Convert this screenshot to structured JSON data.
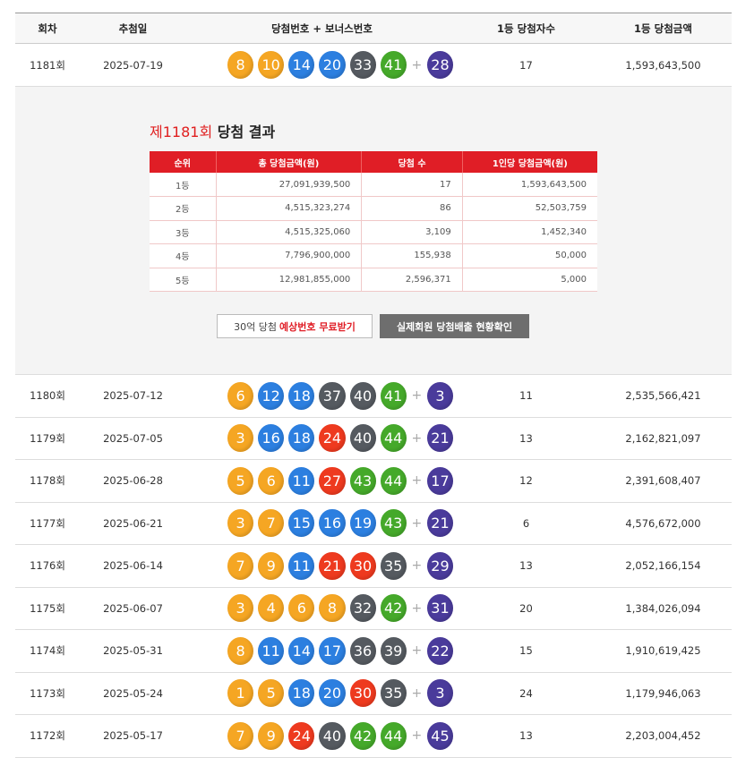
{
  "headers": {
    "round": "회차",
    "date": "추첨일",
    "numbers": "당첨번호 + 보너스번호",
    "winners": "1등 당첨자수",
    "prize": "1등 당첨금액"
  },
  "colors": {
    "yellow": "#f5a623",
    "blue": "#2c7fe0",
    "red": "#ee3a1f",
    "gray": "#555a60",
    "green": "#45a92a",
    "purple": "#4a3b9b",
    "accent_red": "#e01e26"
  },
  "draws": [
    {
      "round": "1181회",
      "date": "2025-07-19",
      "numbers": [
        8,
        10,
        14,
        20,
        33,
        41
      ],
      "bonus": 28,
      "winners": "17",
      "prize": "1,593,643,500"
    },
    {
      "round": "1180회",
      "date": "2025-07-12",
      "numbers": [
        6,
        12,
        18,
        37,
        40,
        41
      ],
      "bonus": 3,
      "winners": "11",
      "prize": "2,535,566,421"
    },
    {
      "round": "1179회",
      "date": "2025-07-05",
      "numbers": [
        3,
        16,
        18,
        24,
        40,
        44
      ],
      "bonus": 21,
      "winners": "13",
      "prize": "2,162,821,097"
    },
    {
      "round": "1178회",
      "date": "2025-06-28",
      "numbers": [
        5,
        6,
        11,
        27,
        43,
        44
      ],
      "bonus": 17,
      "winners": "12",
      "prize": "2,391,608,407"
    },
    {
      "round": "1177회",
      "date": "2025-06-21",
      "numbers": [
        3,
        7,
        15,
        16,
        19,
        43
      ],
      "bonus": 21,
      "winners": "6",
      "prize": "4,576,672,000"
    },
    {
      "round": "1176회",
      "date": "2025-06-14",
      "numbers": [
        7,
        9,
        11,
        21,
        30,
        35
      ],
      "bonus": 29,
      "winners": "13",
      "prize": "2,052,166,154"
    },
    {
      "round": "1175회",
      "date": "2025-06-07",
      "numbers": [
        3,
        4,
        6,
        8,
        32,
        42
      ],
      "bonus": 31,
      "winners": "20",
      "prize": "1,384,026,094"
    },
    {
      "round": "1174회",
      "date": "2025-05-31",
      "numbers": [
        8,
        11,
        14,
        17,
        36,
        39
      ],
      "bonus": 22,
      "winners": "15",
      "prize": "1,910,619,425"
    },
    {
      "round": "1173회",
      "date": "2025-05-24",
      "numbers": [
        1,
        5,
        18,
        20,
        30,
        35
      ],
      "bonus": 3,
      "winners": "24",
      "prize": "1,179,946,063"
    },
    {
      "round": "1172회",
      "date": "2025-05-17",
      "numbers": [
        7,
        9,
        24,
        40,
        42,
        44
      ],
      "bonus": 45,
      "winners": "13",
      "prize": "2,203,004,452"
    }
  ],
  "detail": {
    "title_num": "제1181회",
    "title_rest": " 당첨 결과",
    "columns": [
      "순위",
      "총 당첨금액(원)",
      "당첨 수",
      "1인당 당첨금액(원)"
    ],
    "rows": [
      {
        "rank": "1등",
        "total": "27,091,939,500",
        "count": "17",
        "per": "1,593,643,500"
      },
      {
        "rank": "2등",
        "total": "4,515,323,274",
        "count": "86",
        "per": "52,503,759"
      },
      {
        "rank": "3등",
        "total": "4,515,325,060",
        "count": "3,109",
        "per": "1,452,340"
      },
      {
        "rank": "4등",
        "total": "7,796,900,000",
        "count": "155,938",
        "per": "50,000"
      },
      {
        "rank": "5등",
        "total": "12,981,855,000",
        "count": "2,596,371",
        "per": "5,000"
      }
    ],
    "btn_free_prefix": "30억 당첨 ",
    "btn_free_highlight": "예상번호 무료받기",
    "btn_check": "실제회원 당첨배출 현황확인"
  }
}
